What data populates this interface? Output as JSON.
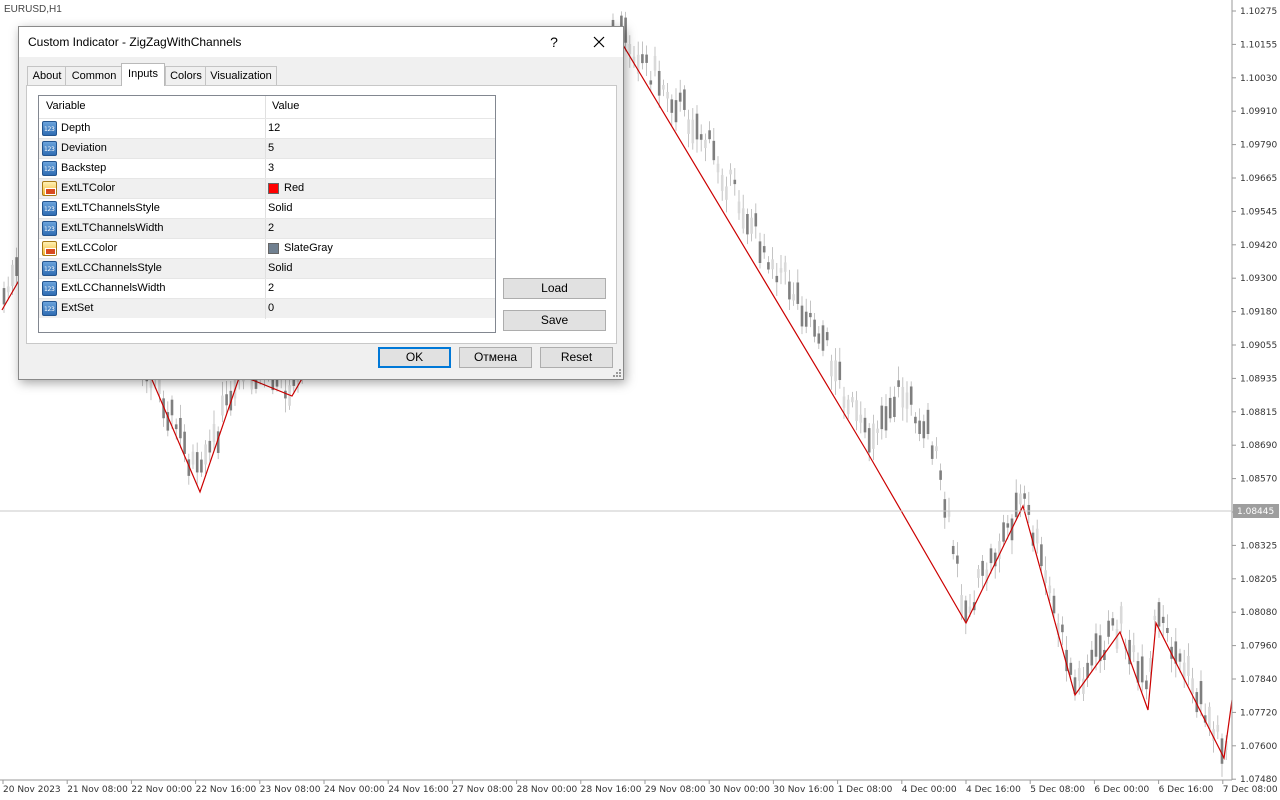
{
  "chart": {
    "symbol": "EURUSD,H1",
    "current_price": "1.08445",
    "price_ticks": [
      "1.10275",
      "1.10155",
      "1.10030",
      "1.09910",
      "1.09790",
      "1.09665",
      "1.09545",
      "1.09420",
      "1.09300",
      "1.09180",
      "1.09055",
      "1.08935",
      "1.08815",
      "1.08690",
      "1.08570",
      "1.08445",
      "1.08325",
      "1.08205",
      "1.08080",
      "1.07960",
      "1.07840",
      "1.07720",
      "1.07600",
      "1.07480"
    ],
    "time_ticks": [
      "20 Nov 2023",
      "21 Nov 08:00",
      "22 Nov 00:00",
      "22 Nov 16:00",
      "23 Nov 08:00",
      "24 Nov 00:00",
      "24 Nov 16:00",
      "27 Nov 08:00",
      "28 Nov 00:00",
      "28 Nov 16:00",
      "29 Nov 08:00",
      "30 Nov 00:00",
      "30 Nov 16:00",
      "1 Dec 08:00",
      "4 Dec 00:00",
      "4 Dec 16:00",
      "5 Dec 08:00",
      "6 Dec 00:00",
      "6 Dec 16:00",
      "7 Dec 08:00"
    ],
    "zigzag_color": "#cc0000",
    "candle_color": "#7f7f7f"
  },
  "dialog": {
    "title": "Custom Indicator - ZigZagWithChannels",
    "help": "?",
    "close": "✕",
    "tabs": [
      {
        "label": "About"
      },
      {
        "label": "Common"
      },
      {
        "label": "Inputs"
      },
      {
        "label": "Colors"
      },
      {
        "label": "Visualization"
      }
    ],
    "active_tab": "Inputs",
    "grid": {
      "col_variable": "Variable",
      "col_value": "Value",
      "rows": [
        {
          "variable": "Depth",
          "value": "12",
          "icon": "number-icon"
        },
        {
          "variable": "Deviation",
          "value": "5",
          "icon": "number-icon"
        },
        {
          "variable": "Backstep",
          "value": "3",
          "icon": "number-icon"
        },
        {
          "variable": "ExtLTColor",
          "value": "Red",
          "icon": "color-icon",
          "swatch": "#ff0000"
        },
        {
          "variable": "ExtLTChannelsStyle",
          "value": "Solid",
          "icon": "number-icon"
        },
        {
          "variable": "ExtLTChannelsWidth",
          "value": "2",
          "icon": "number-icon"
        },
        {
          "variable": "ExtLCColor",
          "value": "SlateGray",
          "icon": "color-icon",
          "swatch": "#708090"
        },
        {
          "variable": "ExtLCChannelsStyle",
          "value": "Solid",
          "icon": "number-icon"
        },
        {
          "variable": "ExtLCChannelsWidth",
          "value": "2",
          "icon": "number-icon"
        },
        {
          "variable": "ExtSet",
          "value": "0",
          "icon": "number-icon"
        }
      ]
    },
    "buttons": {
      "load": "Load",
      "save": "Save",
      "ok": "OK",
      "cancel": "Отмена",
      "reset": "Reset"
    }
  }
}
